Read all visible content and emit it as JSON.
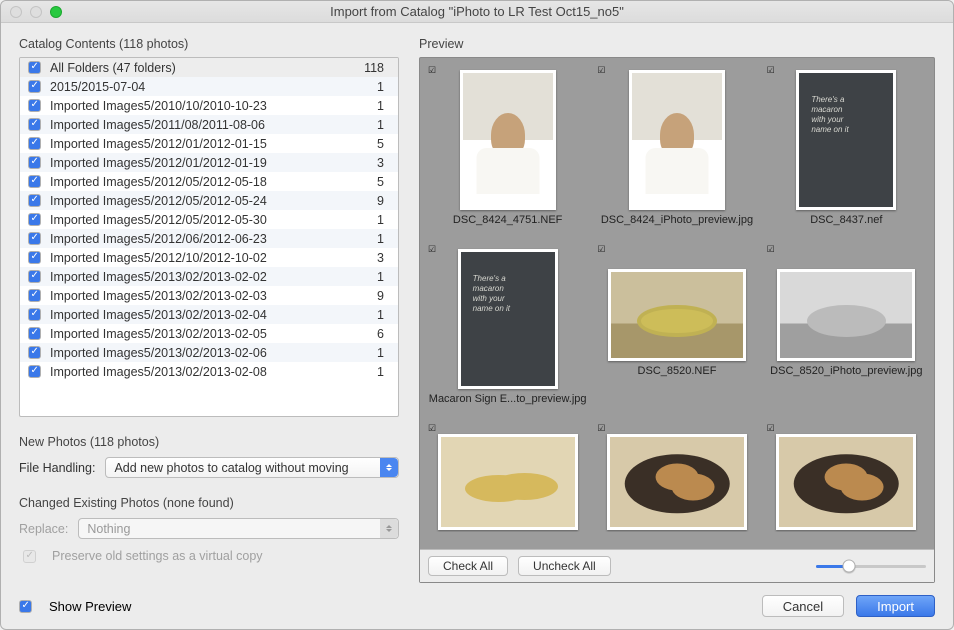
{
  "window": {
    "title": "Import from Catalog \"iPhoto to LR Test Oct15_no5\""
  },
  "catalog": {
    "header": "Catalog Contents (118 photos)",
    "rows": [
      {
        "name": "All Folders (47 folders)",
        "count": "118"
      },
      {
        "name": "2015/2015-07-04",
        "count": "1"
      },
      {
        "name": "Imported Images5/2010/10/2010-10-23",
        "count": "1"
      },
      {
        "name": "Imported Images5/2011/08/2011-08-06",
        "count": "1"
      },
      {
        "name": "Imported Images5/2012/01/2012-01-15",
        "count": "5"
      },
      {
        "name": "Imported Images5/2012/01/2012-01-19",
        "count": "3"
      },
      {
        "name": "Imported Images5/2012/05/2012-05-18",
        "count": "5"
      },
      {
        "name": "Imported Images5/2012/05/2012-05-24",
        "count": "9"
      },
      {
        "name": "Imported Images5/2012/05/2012-05-30",
        "count": "1"
      },
      {
        "name": "Imported Images5/2012/06/2012-06-23",
        "count": "1"
      },
      {
        "name": "Imported Images5/2012/10/2012-10-02",
        "count": "3"
      },
      {
        "name": "Imported Images5/2013/02/2013-02-02",
        "count": "1"
      },
      {
        "name": "Imported Images5/2013/02/2013-02-03",
        "count": "9"
      },
      {
        "name": "Imported Images5/2013/02/2013-02-04",
        "count": "1"
      },
      {
        "name": "Imported Images5/2013/02/2013-02-05",
        "count": "6"
      },
      {
        "name": "Imported Images5/2013/02/2013-02-06",
        "count": "1"
      },
      {
        "name": "Imported Images5/2013/02/2013-02-08",
        "count": "1"
      }
    ]
  },
  "new_photos": {
    "header": "New Photos (118 photos)"
  },
  "file_handling": {
    "label": "File Handling:",
    "value": "Add new photos to catalog without moving"
  },
  "changed": {
    "header": "Changed Existing Photos (none found)",
    "replace_label": "Replace:",
    "replace_value": "Nothing",
    "preserve_label": "Preserve old settings as a virtual copy"
  },
  "preview": {
    "header": "Preview",
    "thumbnails": [
      {
        "label": "DSC_8424_4751.NEF",
        "art": "chef",
        "orient": "portrait"
      },
      {
        "label": "DSC_8424_iPhoto_preview.jpg",
        "art": "chef",
        "orient": "portrait"
      },
      {
        "label": "DSC_8437.nef",
        "art": "board",
        "orient": "tall"
      },
      {
        "label": "Macaron Sign E...to_preview.jpg",
        "art": "board",
        "orient": "tall"
      },
      {
        "label": "DSC_8520.NEF",
        "art": "mac-color",
        "orient": "landscape"
      },
      {
        "label": "DSC_8520_iPhoto_preview.jpg",
        "art": "mac-bw",
        "orient": "landscape"
      },
      {
        "label": "",
        "art": "mac-stack",
        "orient": "landscape"
      },
      {
        "label": "",
        "art": "plate",
        "orient": "landscape"
      },
      {
        "label": "",
        "art": "plate",
        "orient": "landscape"
      }
    ],
    "check_all": "Check All",
    "uncheck_all": "Uncheck All"
  },
  "footer": {
    "show_preview": "Show Preview",
    "cancel": "Cancel",
    "import": "Import"
  }
}
